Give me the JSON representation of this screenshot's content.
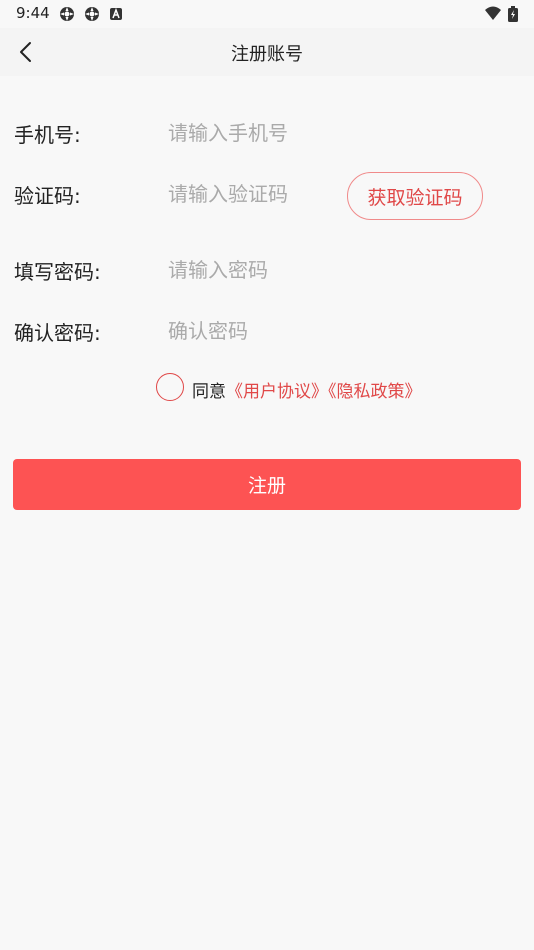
{
  "status_bar": {
    "time": "9:44",
    "icons": [
      "settings-icon",
      "settings-icon",
      "notification-a-icon",
      "wifi-icon",
      "battery-charging-icon"
    ]
  },
  "header": {
    "title": "注册账号",
    "back_icon": "chevron-left-icon"
  },
  "form": {
    "phone": {
      "label": "手机号:",
      "placeholder": "请输入手机号",
      "value": ""
    },
    "code": {
      "label": "验证码:",
      "placeholder": "请输入验证码",
      "value": "",
      "button_label": "获取验证码"
    },
    "password": {
      "label": "填写密码:",
      "placeholder": "请输入密码",
      "value": ""
    },
    "confirm_password": {
      "label": "确认密码:",
      "placeholder": "确认密码",
      "value": ""
    }
  },
  "agreement": {
    "checked": false,
    "prefix": "同意",
    "user_agreement": "《用户协议》",
    "privacy_policy": "《隐私政策》"
  },
  "register_button": {
    "label": "注册"
  },
  "colors": {
    "accent": "#fd5353",
    "link": "#e04848",
    "background": "#f8f8f8",
    "placeholder": "#aaaaaa"
  }
}
